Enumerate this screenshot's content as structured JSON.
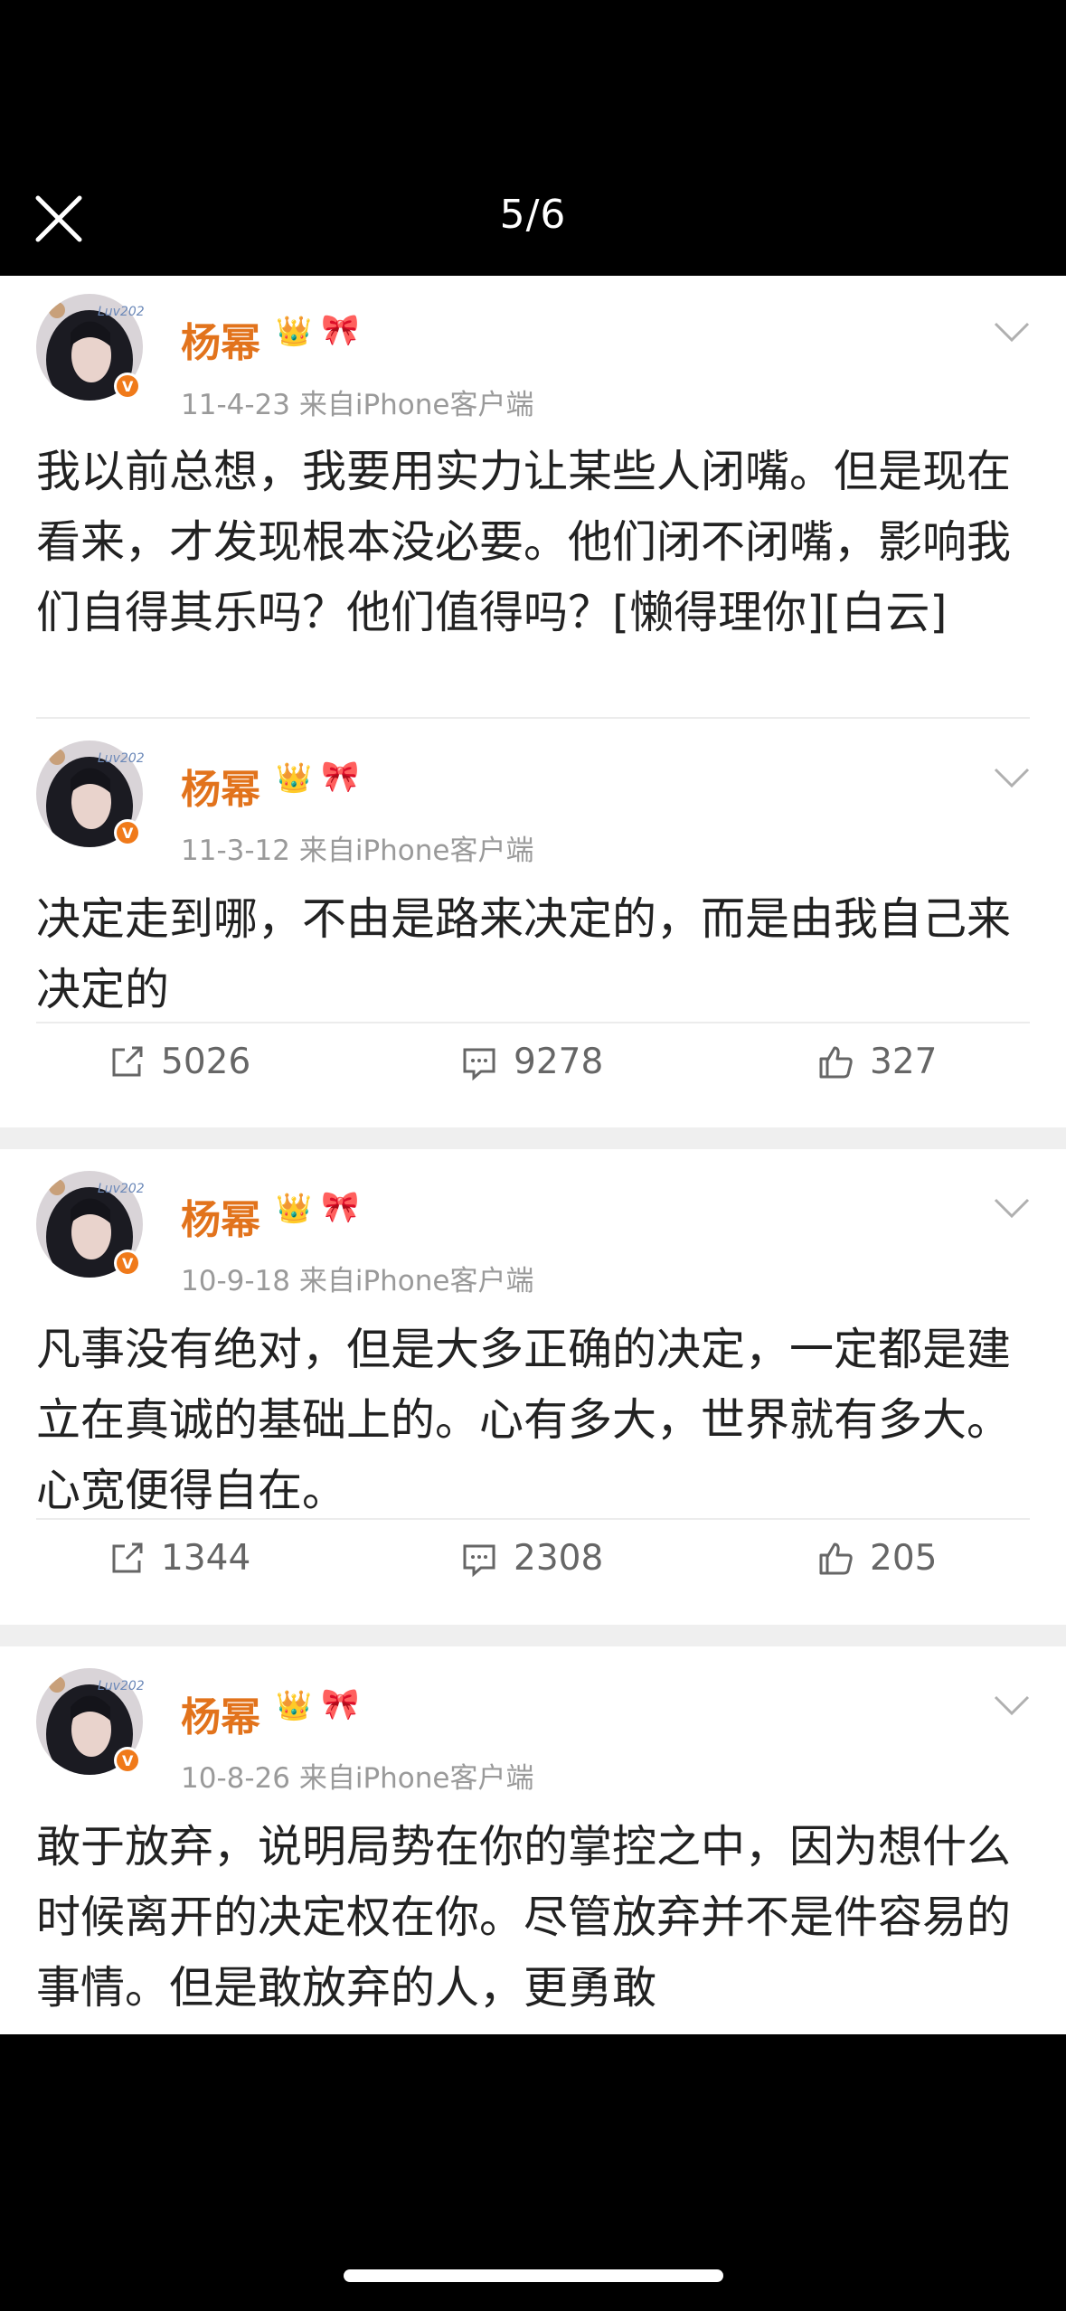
{
  "viewer": {
    "counter": "5/6",
    "close_icon": "close-icon"
  },
  "posts": [
    {
      "author": "杨幂",
      "meta": "11-4-23  来自iPhone客户端",
      "text": "我以前总想，我要用实力让某些人闭嘴。但是现在看来，才发现根本没必要。他们闭不闭嘴，影响我们自得其乐吗？他们值得吗？[懒得理你][白云]"
    },
    {
      "author": "杨幂",
      "meta": "11-3-12  来自iPhone客户端",
      "text": "决定走到哪，不由是路来决定的，而是由我自己来决定的",
      "reposts": "5026",
      "comments": "9278",
      "likes": "327"
    },
    {
      "author": "杨幂",
      "meta": "10-9-18  来自iPhone客户端",
      "text": "凡事没有绝对，但是大多正确的决定，一定都是建立在真诚的基础上的。心有多大，世界就有多大。心宽便得自在。",
      "reposts": "1344",
      "comments": "2308",
      "likes": "205"
    },
    {
      "author": "杨幂",
      "meta": "10-8-26  来自iPhone客户端",
      "text": "敢于放弃，说明局势在你的掌控之中，因为想什么时候离开的决定权在你。尽管放弃并不是件容易的事情。但是敢放弃的人，更勇敢"
    }
  ],
  "colors": {
    "author": "#e2731c",
    "meta": "#9a9a9a",
    "verified": "#f07a1a",
    "background": "#000000"
  }
}
